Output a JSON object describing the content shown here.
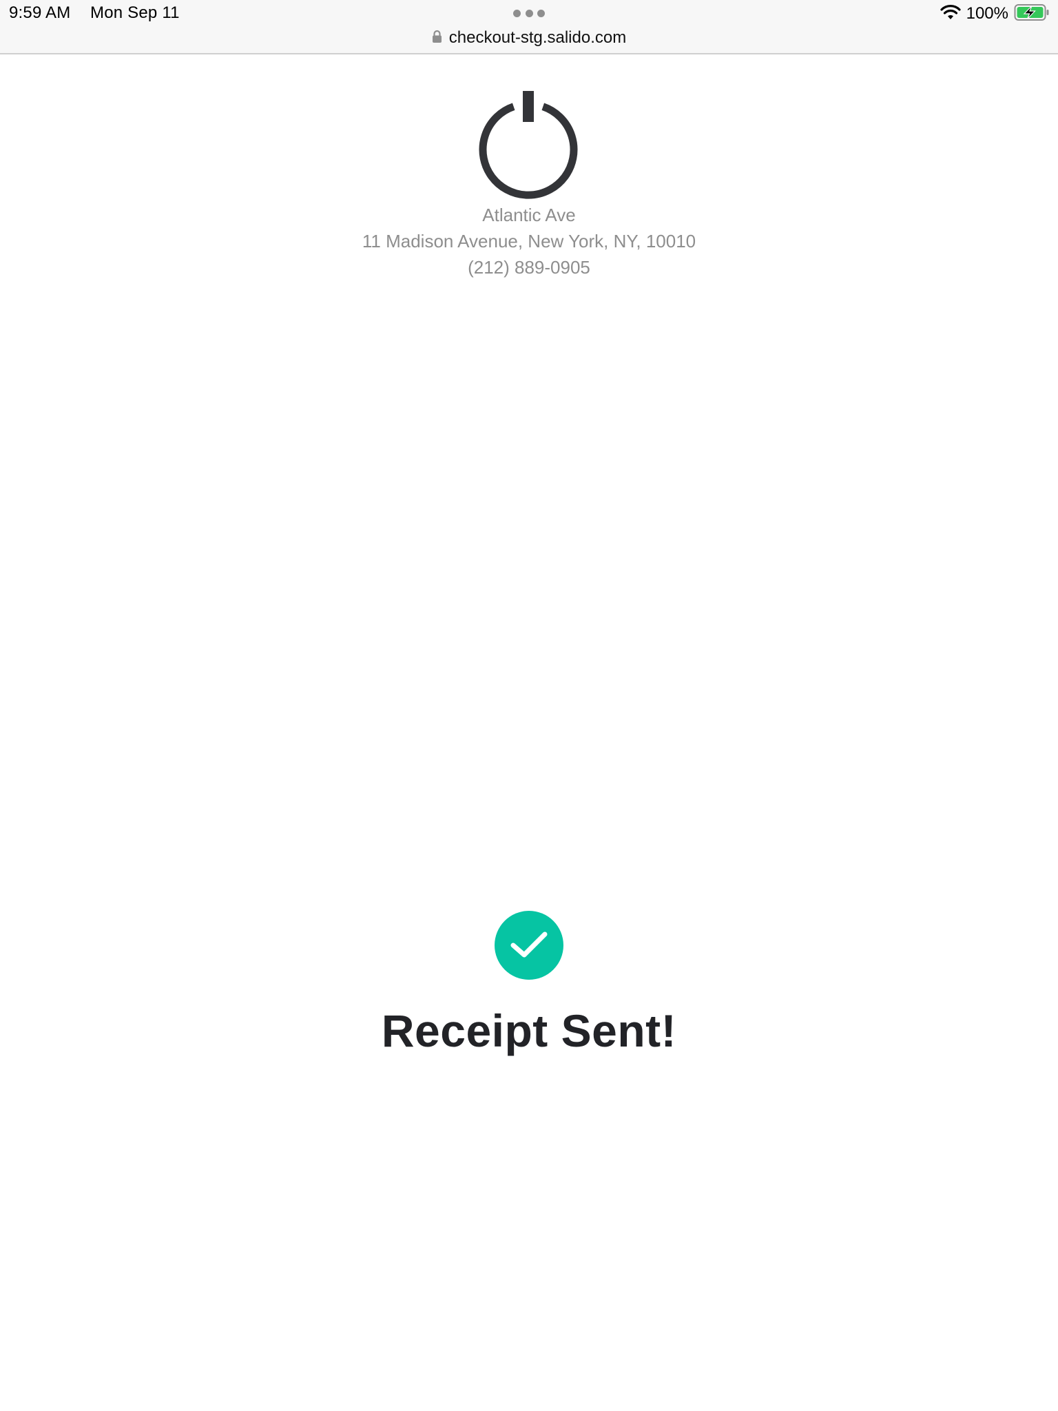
{
  "status_bar": {
    "time": "9:59 AM",
    "date": "Mon Sep 11",
    "battery_percent": "100%",
    "icons": [
      "wifi-icon",
      "battery-charging-icon"
    ]
  },
  "browser": {
    "url": "checkout-stg.salido.com",
    "icons": [
      "lock-icon",
      "multitask-dots-icon"
    ]
  },
  "merchant": {
    "logo_icon": "power-icon",
    "name": "Atlantic Ave",
    "address": "11 Madison Avenue, New York, NY, 10010",
    "phone": "(212) 889-0905"
  },
  "confirmation": {
    "icon": "checkmark-icon",
    "title": "Receipt Sent!"
  },
  "colors": {
    "accent": "#06c4a3",
    "logo": "#333438",
    "muted_text": "#8e8e8e",
    "title_text": "#222327",
    "battery_fill": "#34c759"
  }
}
